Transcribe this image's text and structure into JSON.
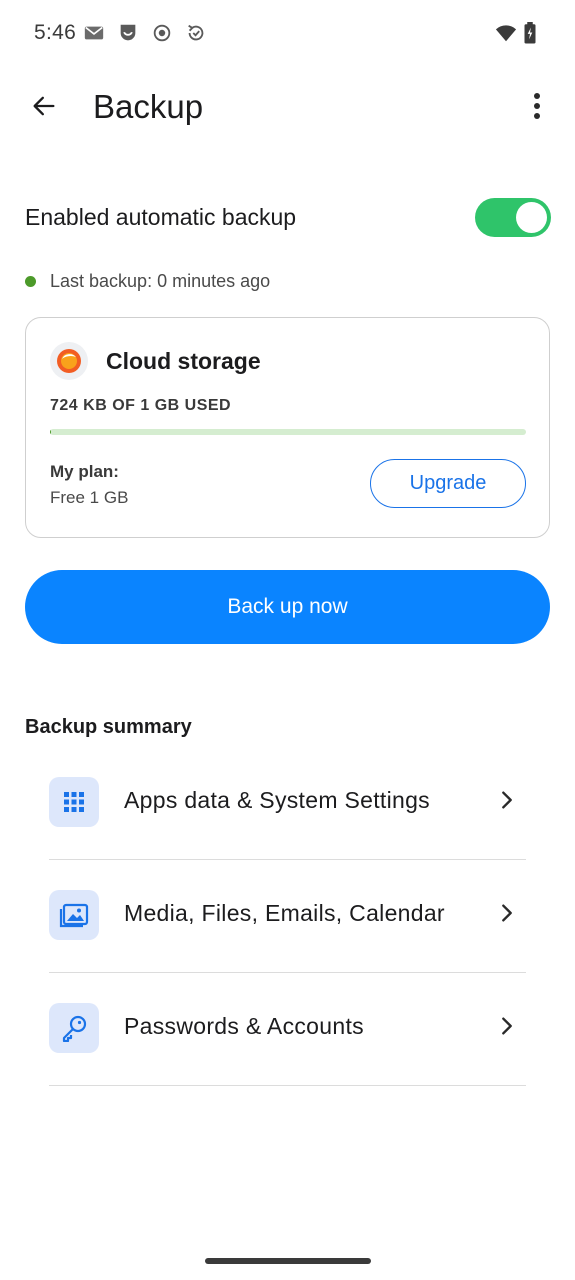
{
  "status_bar": {
    "time": "5:46",
    "icons": [
      "mail-icon",
      "shield-app-icon",
      "record-icon",
      "sync-icon",
      "wifi-icon",
      "battery-icon"
    ]
  },
  "app_bar": {
    "title": "Backup",
    "icons": [
      "back-arrow-icon",
      "more-vert-icon"
    ]
  },
  "auto_backup": {
    "label": "Enabled automatic backup",
    "enabled": true,
    "toggle_color": "#2fc46a",
    "last_backup": "Last backup: 0 minutes ago",
    "status_color": "#4c9a2a"
  },
  "cloud_storage": {
    "title": "Cloud storage",
    "icon": "cloud-logo-icon",
    "usage_text": "724 KB OF 1 GB USED",
    "usage_fraction": 0.0007,
    "plan_label": "My plan:",
    "plan_value": "Free 1 GB",
    "upgrade_label": "Upgrade"
  },
  "backup_now": {
    "label": "Back up now",
    "color": "#0a84ff"
  },
  "summary": {
    "heading": "Backup summary",
    "items": [
      {
        "label": "Apps data & System Settings",
        "icon": "apps-grid-icon"
      },
      {
        "label": "Media, Files, Emails, Calendar",
        "icon": "media-gallery-icon"
      },
      {
        "label": "Passwords & Accounts",
        "icon": "key-icon"
      }
    ]
  }
}
